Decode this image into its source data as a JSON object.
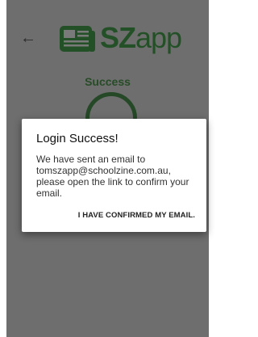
{
  "header": {
    "back_icon": "arrow-left-icon",
    "logo_icon": "newspaper-icon",
    "logo_bold": "SZ",
    "logo_light": "app"
  },
  "main": {
    "status_text": "Success",
    "status_icon": "check-circle-icon"
  },
  "dialog": {
    "title": "Login Success!",
    "message_lines": [
      "We have sent an email to",
      "tomszapp@schoolzine.com.au,",
      "please open the link to confirm your",
      "email."
    ],
    "action_label": "I HAVE CONFIRMED MY EMAIL."
  },
  "colors": {
    "overlay_background": "#6e6e6e",
    "brand_green": "#245027",
    "dialog_background": "#ffffff"
  }
}
